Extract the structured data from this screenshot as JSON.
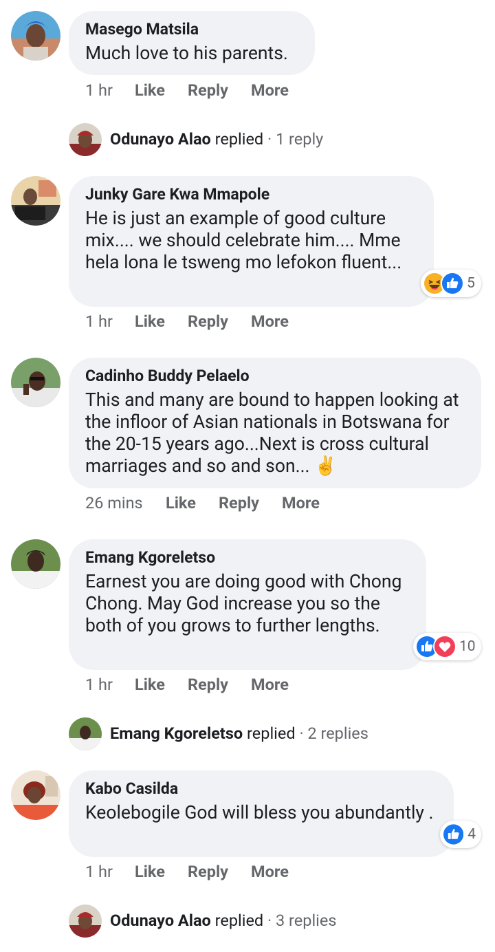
{
  "comments": [
    {
      "author": "Masego Matsila",
      "text": "Much love to his parents.",
      "time": "1 hr",
      "like": "Like",
      "reply": "Reply",
      "more": "More",
      "avatar_icon": "avatar-icon"
    },
    {
      "author": "Junky Gare Kwa Mmapole",
      "text": "He is just an example of good culture mix.... we should celebrate him.... Mme hela lona le tsweng mo lefokon fluent...",
      "time": "1 hr",
      "like": "Like",
      "reply": "Reply",
      "more": "More",
      "reactions": [
        "haha-icon",
        "like-icon"
      ],
      "reaction_count": "5",
      "avatar_icon": "avatar-icon"
    },
    {
      "author": "Cadinho Buddy Pelaelo",
      "text": "This and many are bound to happen looking at the infloor of Asian nationals in Botswana for the 20-15 years ago...Next is cross cultural marriages and so and son... ✌️",
      "time": "26 mins",
      "like": "Like",
      "reply": "Reply",
      "more": "More",
      "avatar_icon": "avatar-icon"
    },
    {
      "author": "Emang Kgoreletso",
      "text": "Earnest you are doing good with Chong Chong. May God increase you so the both of you grows to further lengths.",
      "time": "1 hr",
      "like": "Like",
      "reply": "Reply",
      "more": "More",
      "reactions": [
        "like-icon",
        "love-icon"
      ],
      "reaction_count": "10",
      "avatar_icon": "avatar-icon"
    },
    {
      "author": "Kabo Casilda",
      "text": "Keolebogile God will bless you abundantly .",
      "time": "1 hr",
      "like": "Like",
      "reply": "Reply",
      "more": "More",
      "reactions": [
        "like-icon"
      ],
      "reaction_count": "4",
      "avatar_icon": "avatar-icon"
    }
  ],
  "replies": [
    {
      "name": "Odunayo Alao",
      "verb": "replied",
      "separator": "·",
      "count": "1 reply"
    },
    {
      "name": "Emang Kgoreletso",
      "verb": "replied",
      "separator": "·",
      "count": "2 replies"
    },
    {
      "name": "Odunayo Alao",
      "verb": "replied",
      "separator": "·",
      "count": "3 replies"
    }
  ],
  "colors": {
    "bubble_bg": "#f0f2f5",
    "secondary_text": "#65676b",
    "like_blue": "#1877f2",
    "love_red": "#f33e58",
    "haha_yellow": "#f7b125"
  }
}
